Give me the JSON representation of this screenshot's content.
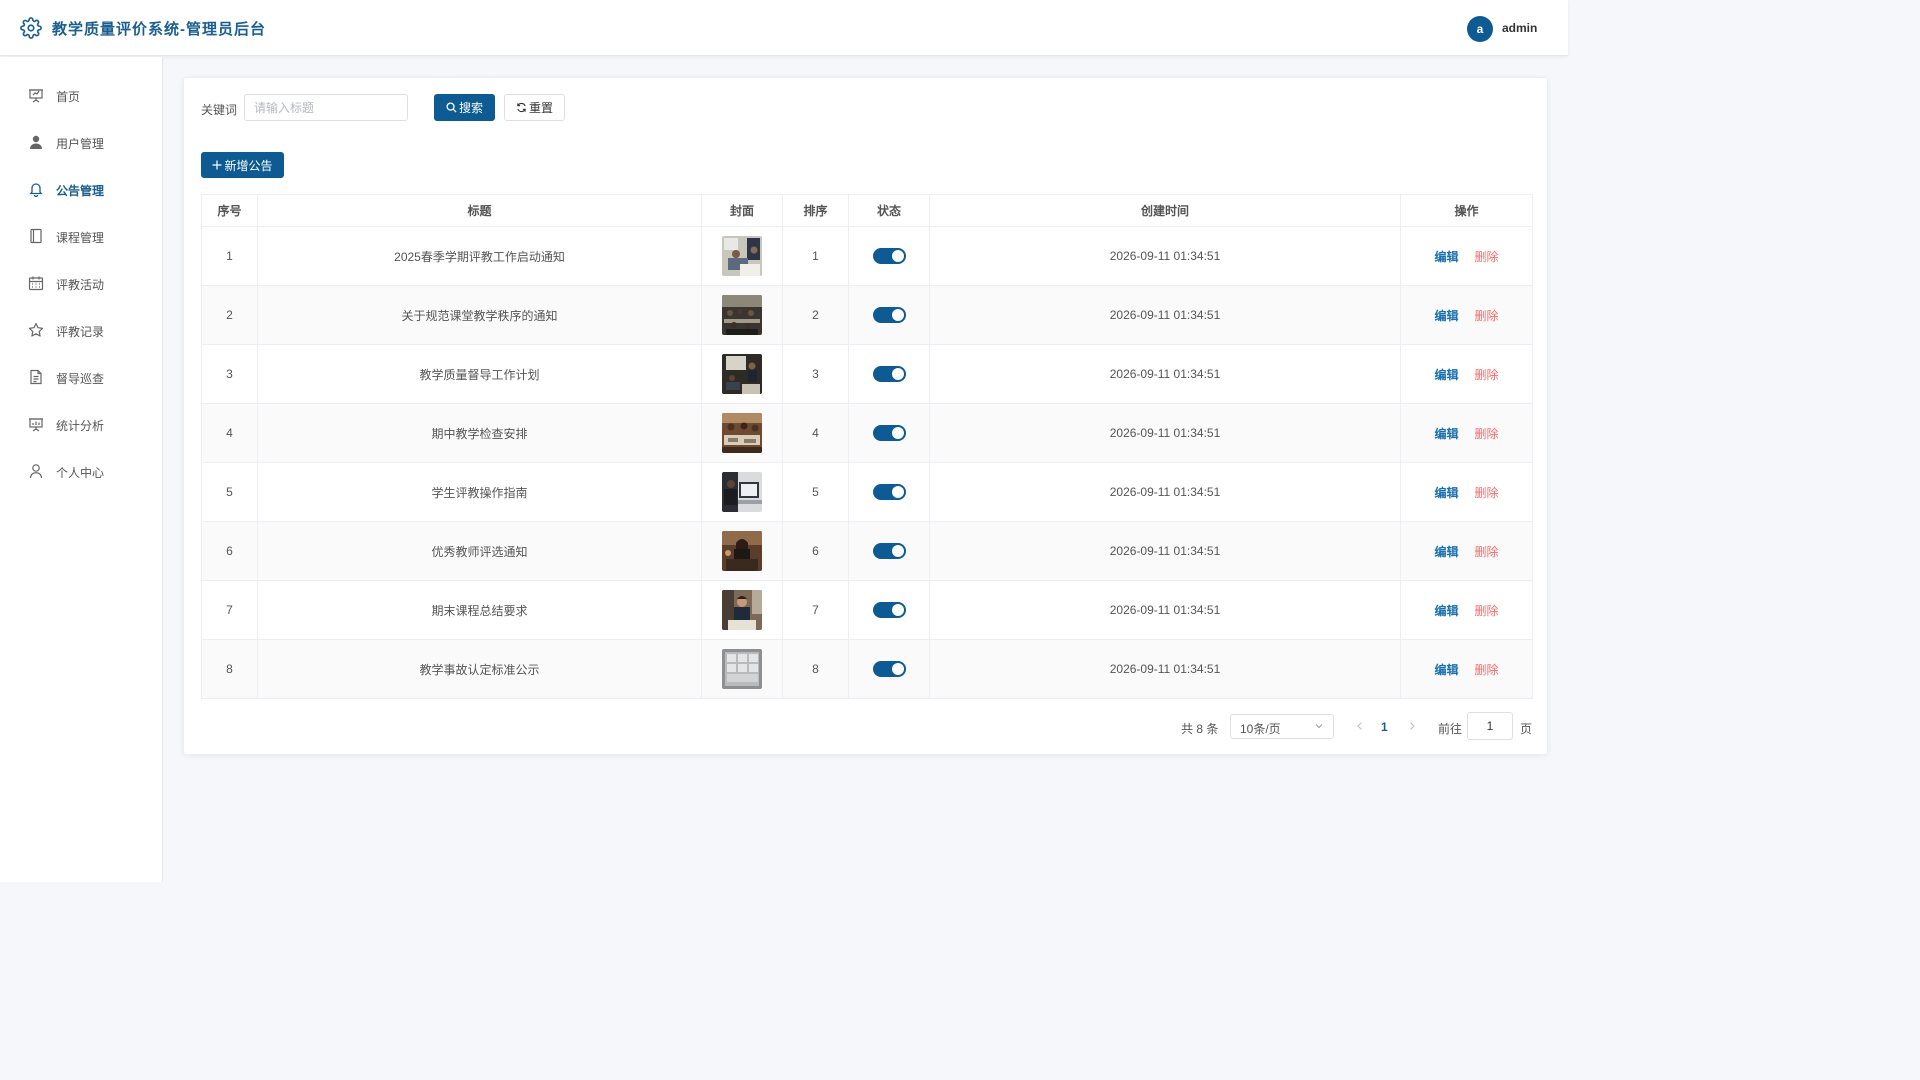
{
  "header": {
    "title": "教学质量评价系统-管理员后台",
    "avatar_letter": "a",
    "username": "admin"
  },
  "sidebar": {
    "items": [
      {
        "label": "首页",
        "icon": "presentation-icon"
      },
      {
        "label": "用户管理",
        "icon": "user-icon"
      },
      {
        "label": "公告管理",
        "icon": "bell-icon",
        "active": true
      },
      {
        "label": "课程管理",
        "icon": "notebook-icon"
      },
      {
        "label": "评教活动",
        "icon": "calendar-icon"
      },
      {
        "label": "评教记录",
        "icon": "star-icon"
      },
      {
        "label": "督导巡查",
        "icon": "document-icon"
      },
      {
        "label": "统计分析",
        "icon": "chart-board-icon"
      },
      {
        "label": "个人中心",
        "icon": "user-outline-icon"
      }
    ]
  },
  "search": {
    "keyword_label": "关键词",
    "placeholder": "请输入标题",
    "value": "",
    "search_label": "搜索",
    "reset_label": "重置"
  },
  "toolbar": {
    "add_label": "新增公告"
  },
  "table": {
    "columns": [
      "序号",
      "标题",
      "封面",
      "排序",
      "状态",
      "创建时间",
      "操作"
    ],
    "edit_label": "编辑",
    "delete_label": "删除",
    "rows": [
      {
        "no": "1",
        "title": "2025春季学期评教工作启动通知",
        "sort": "1",
        "enabled": true,
        "created": "2026-09-11 01:34:51"
      },
      {
        "no": "2",
        "title": "关于规范课堂教学秩序的通知",
        "sort": "2",
        "enabled": true,
        "created": "2026-09-11 01:34:51"
      },
      {
        "no": "3",
        "title": "教学质量督导工作计划",
        "sort": "3",
        "enabled": true,
        "created": "2026-09-11 01:34:51"
      },
      {
        "no": "4",
        "title": "期中教学检查安排",
        "sort": "4",
        "enabled": true,
        "created": "2026-09-11 01:34:51"
      },
      {
        "no": "5",
        "title": "学生评教操作指南",
        "sort": "5",
        "enabled": true,
        "created": "2026-09-11 01:34:51"
      },
      {
        "no": "6",
        "title": "优秀教师评选通知",
        "sort": "6",
        "enabled": true,
        "created": "2026-09-11 01:34:51"
      },
      {
        "no": "7",
        "title": "期末课程总结要求",
        "sort": "7",
        "enabled": true,
        "created": "2026-09-11 01:34:51"
      },
      {
        "no": "8",
        "title": "教学事故认定标准公示",
        "sort": "8",
        "enabled": true,
        "created": "2026-09-11 01:34:51"
      }
    ]
  },
  "pagination": {
    "total_text": "共 8 条",
    "page_size": "10条/页",
    "current_page": "1",
    "goto_label": "前往",
    "goto_value": "1",
    "page_suffix": "页"
  },
  "colors": {
    "primary": "#0d5b92",
    "title": "#1a5f8f",
    "danger": "#f56c6c"
  }
}
